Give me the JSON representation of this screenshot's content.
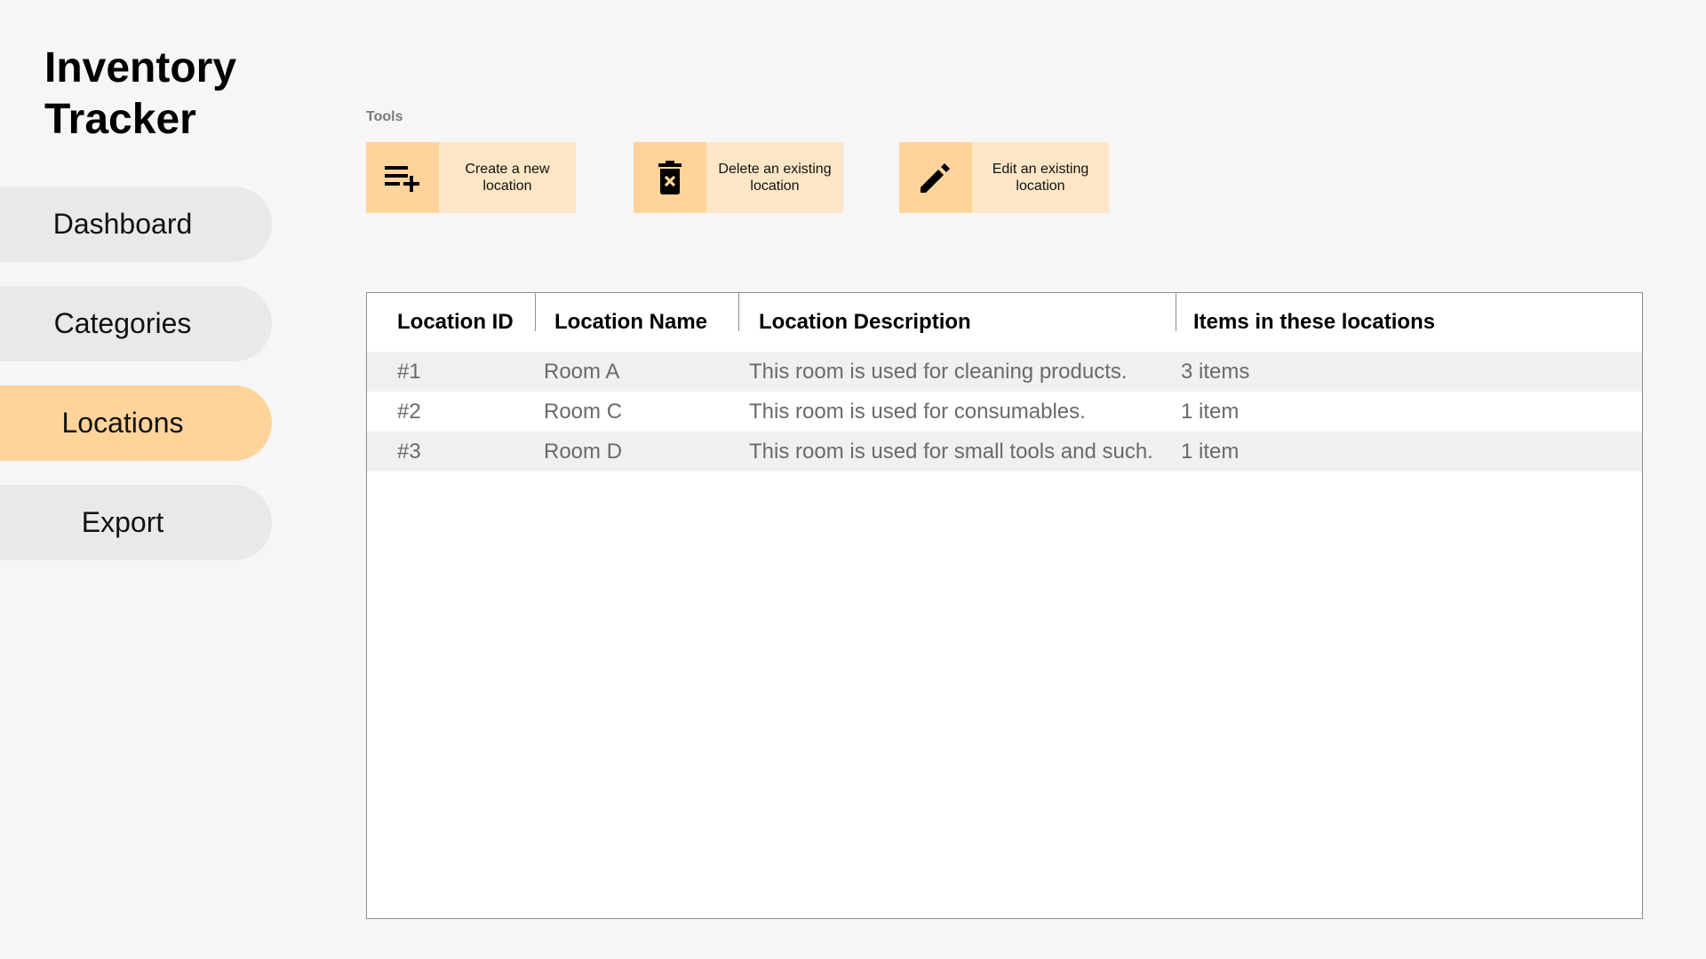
{
  "app": {
    "title": "Inventory Tracker"
  },
  "sidebar": {
    "items": [
      {
        "label": "Dashboard",
        "active": false
      },
      {
        "label": "Categories",
        "active": false
      },
      {
        "label": "Locations",
        "active": true
      },
      {
        "label": "Export",
        "active": false
      }
    ]
  },
  "tools": {
    "label": "Tools",
    "buttons": [
      {
        "label": "Create a new location",
        "icon": "playlist-add-icon"
      },
      {
        "label": "Delete an existing location",
        "icon": "trash-x-icon"
      },
      {
        "label": "Edit an existing location",
        "icon": "pencil-icon"
      }
    ]
  },
  "table": {
    "columns": [
      "Location ID",
      "Location Name",
      "Location Description",
      "Items in these locations"
    ],
    "rows": [
      {
        "id": "#1",
        "name": "Room A",
        "description": "This room is used for cleaning products.",
        "items": "3 items"
      },
      {
        "id": "#2",
        "name": "Room C",
        "description": "This room is used for consumables.",
        "items": "1 item"
      },
      {
        "id": "#3",
        "name": "Room D",
        "description": "This room is used for small tools and such.",
        "items": "1 item"
      }
    ]
  },
  "colors": {
    "accent": "#ffd49b",
    "accent_light": "#fde6c6",
    "nav_inactive": "#e9e9e9",
    "background": "#f6f6f6"
  }
}
